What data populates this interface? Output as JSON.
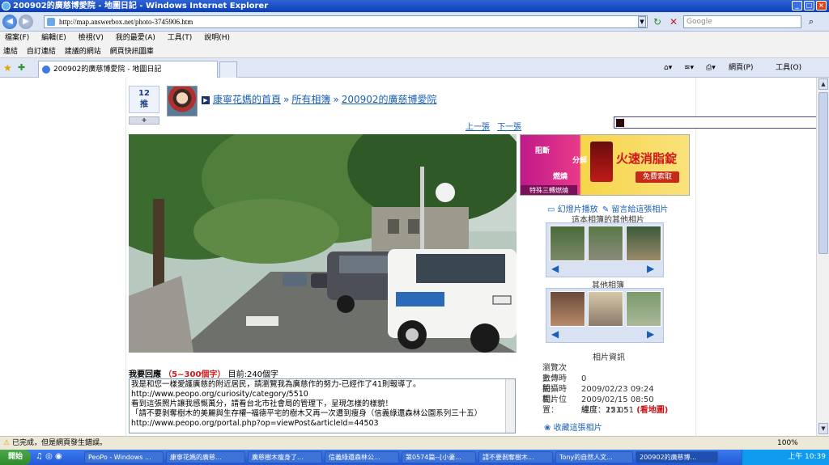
{
  "window": {
    "title": "200902的廣慈博愛院 - 地圖日記 - Windows Internet Explorer"
  },
  "address": {
    "url": "http://map.answerbox.net/photo-3745906.htm",
    "search_placeholder": "Google"
  },
  "menu": [
    "檔案(F)",
    "編輯(E)",
    "檢視(V)",
    "我的最愛(A)",
    "工具(T)",
    "說明(H)"
  ],
  "links": [
    "連結",
    "自訂連結",
    "建議的網站",
    "網頁快訊圖庫"
  ],
  "tab": {
    "title": "200902的廣慈博愛院 - 地圖日記"
  },
  "toolbar_right": {
    "page": "網頁(P)",
    "tools": "工具(O)"
  },
  "recommend": {
    "count": "12",
    "label": "推"
  },
  "breadcrumb": {
    "home": "康寧花媽的首頁",
    "all_albums": "所有相簿",
    "album": "200902的廣慈博愛院",
    "sep": "»"
  },
  "pager": {
    "prev": "上一張",
    "next": "下一張"
  },
  "ad": {
    "t1": "阻斷",
    "t2": "分解",
    "t3": "燃燒",
    "headline": "火速消脂錠",
    "cta": "免費索取",
    "footer": "特殊三轉燃燒"
  },
  "side": {
    "slideshow": "幻燈片播放",
    "comment_link": "留言給這張相片",
    "other_photos_title": "這本相簿的其他相片",
    "other_albums_title": "其他相簿",
    "info_title": "相片資訊"
  },
  "info": {
    "views_label": "瀏覽次數：",
    "views": "0",
    "upload_label": "上傳時間：",
    "upload": "2009/02/23 09:24",
    "taken_label": "拍攝時間：",
    "taken": "2009/02/15 08:50",
    "location_label": "相片位置：",
    "lat_label": "緯度：",
    "lat": "25.05",
    "lng_label": "經度：",
    "lng": "121.51",
    "map_link": "(看地圖)",
    "collect": "收藏這張相片"
  },
  "reply": {
    "heading": "我要回應",
    "limit": "（5~300個字）",
    "count": "目前:240個字",
    "lines": [
      "我是和您一樣愛護廣慈的附近居民，請瀏覽我為廣慈作的努力-已經作了41則報導了。",
      "http://www.peopo.org/curiosity/category/5510",
      "看到這張照片讓我感慨萬分，請看台北市社會局的管理下，呈現怎樣的樣貌！",
      "「請不要剝奪樹木的美麗與生存權─福德平宅的樹木又再一次遭到瘦身（信義綠還森林公園系列三十五）",
      "http://www.peopo.org/portal.php?op=viewPost&articleId=44503"
    ]
  },
  "status": {
    "text": "已完成，但是網頁發生錯誤。",
    "zoom": "100%"
  },
  "taskbar": {
    "start": "開始",
    "tasks": [
      "PeoPo - Windows ...",
      "康寧花媽的廣慈...",
      "廣慈樹木瘦身了...",
      "信義綠還森林公...",
      "第0574篇--[小妻...",
      "請不要剝奪樹木...",
      "Tony的自然人文...",
      "200902的廣慈博..."
    ],
    "time": "上午 10:39"
  },
  "colors": {
    "link": "#1a5fb4",
    "accent_red": "#d0161a",
    "titlebar": "#0a3fb8"
  }
}
